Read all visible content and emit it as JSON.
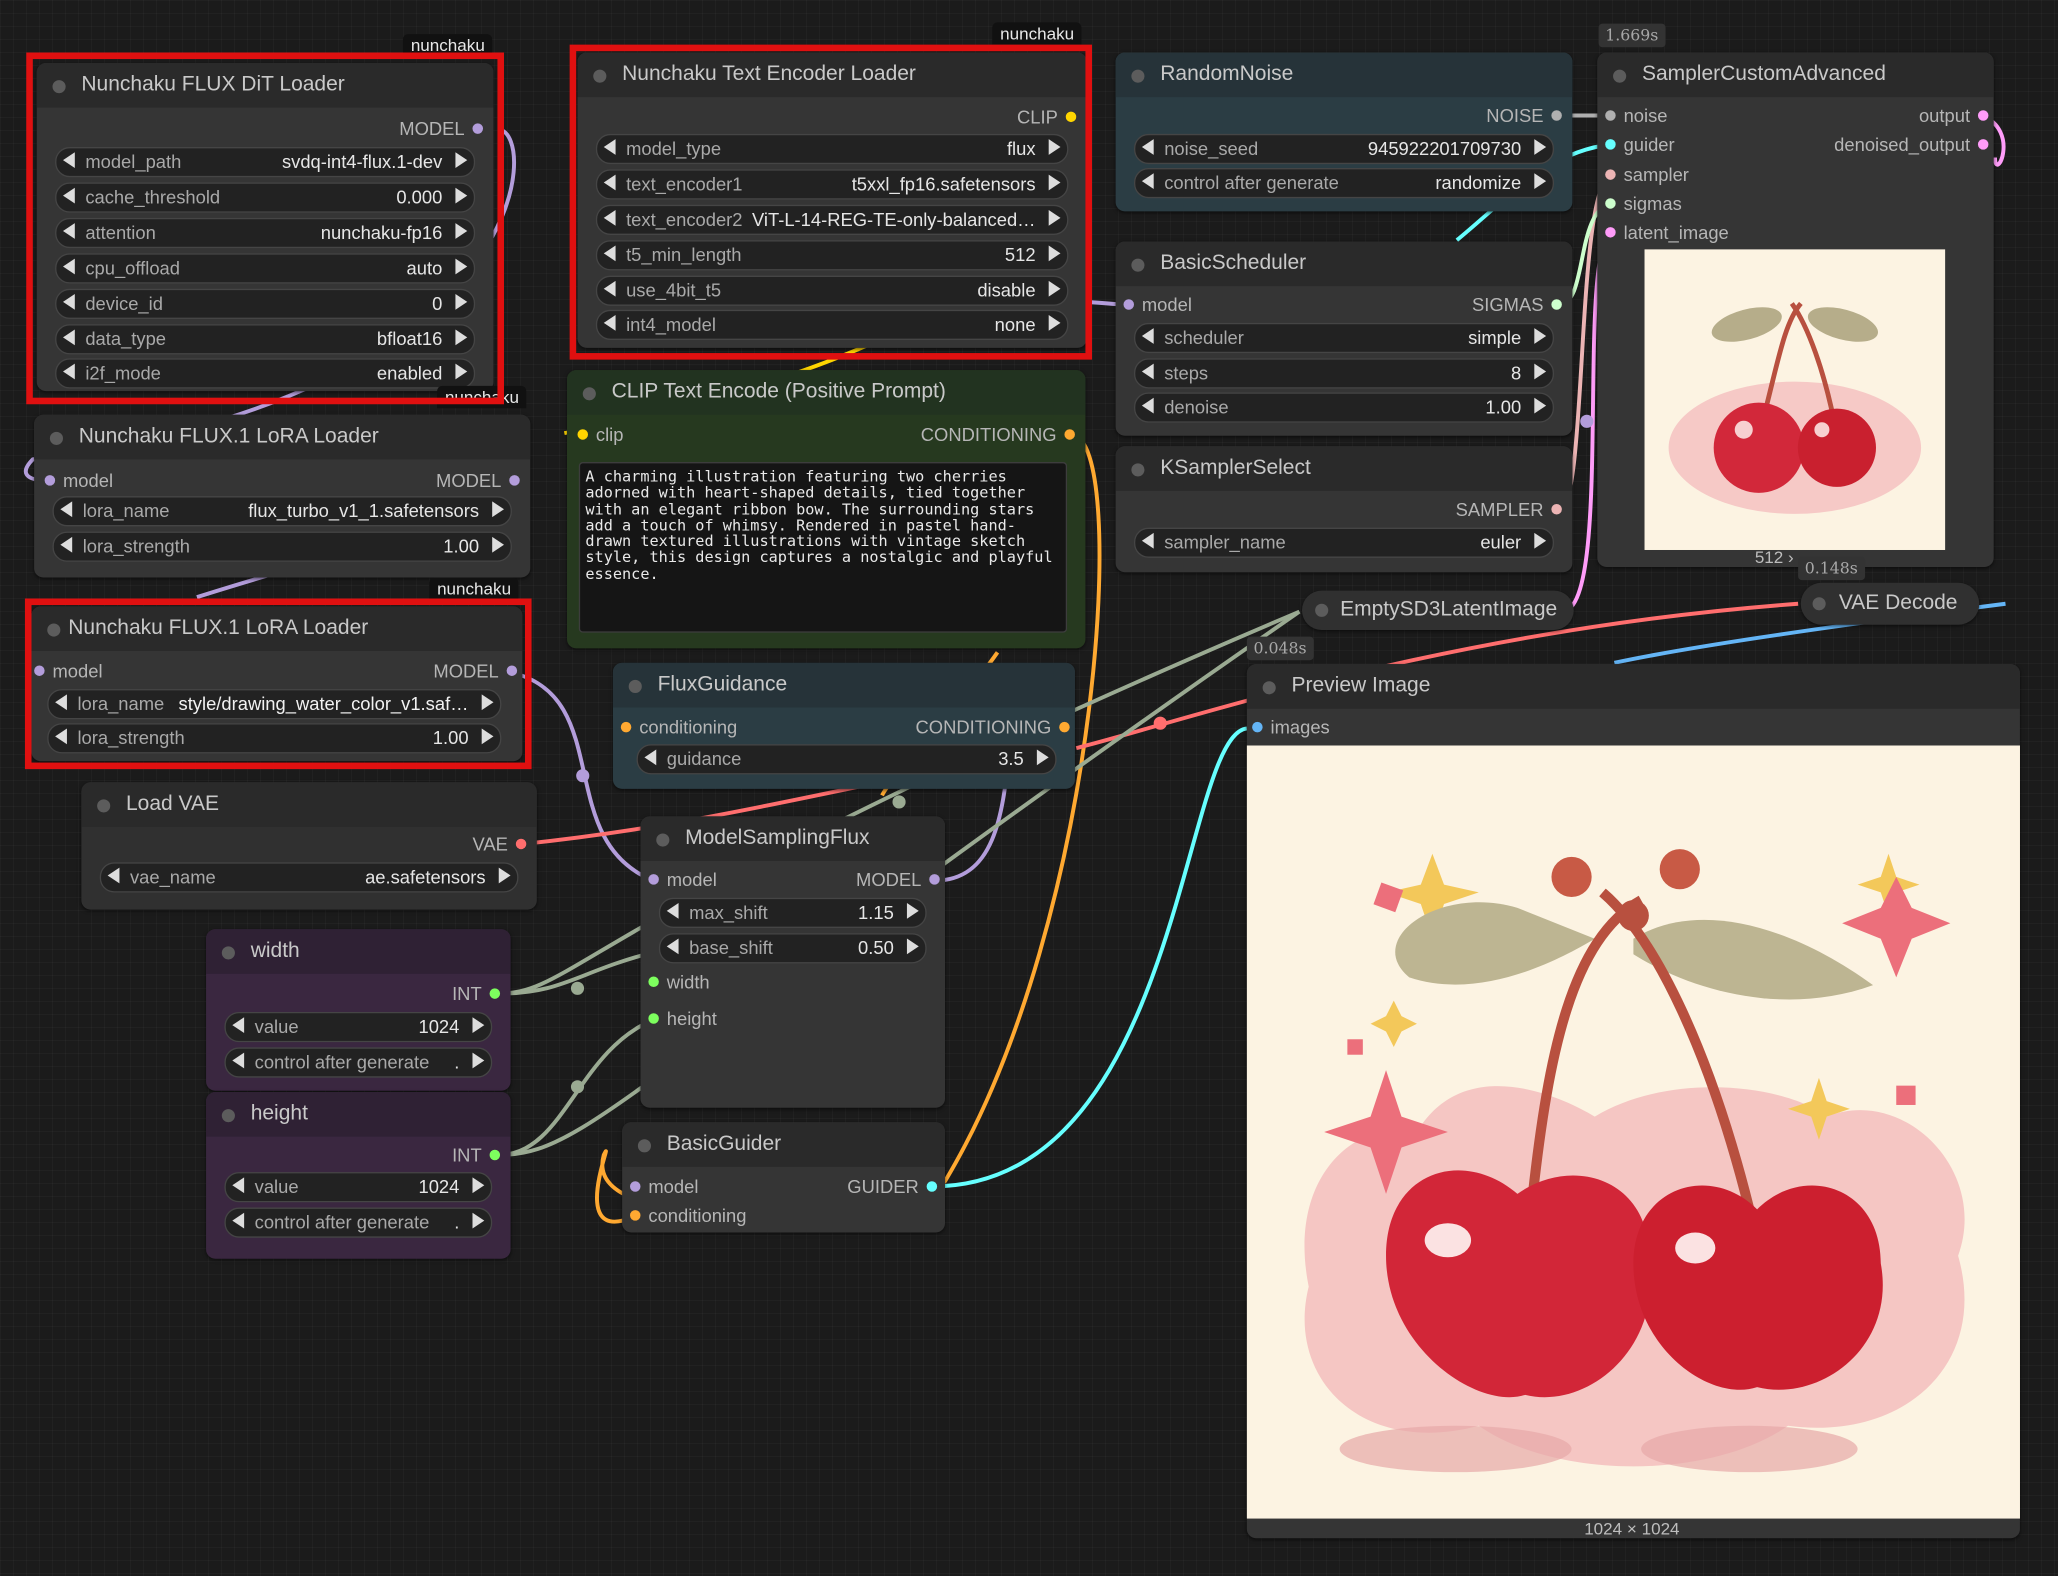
{
  "badges": {
    "nunchaku": "nunchaku"
  },
  "timings": {
    "sampler": "1.669s",
    "vae_decode": "0.148s",
    "empty_latent": "0.048s"
  },
  "dit_loader": {
    "title": "Nunchaku FLUX DiT Loader",
    "output": "MODEL",
    "widgets": [
      {
        "label": "model_path",
        "value": "svdq-int4-flux.1-dev"
      },
      {
        "label": "cache_threshold",
        "value": "0.000"
      },
      {
        "label": "attention",
        "value": "nunchaku-fp16"
      },
      {
        "label": "cpu_offload",
        "value": "auto"
      },
      {
        "label": "device_id",
        "value": "0"
      },
      {
        "label": "data_type",
        "value": "bfloat16"
      },
      {
        "label": "i2f_mode",
        "value": "enabled"
      }
    ]
  },
  "text_encoder_loader": {
    "title": "Nunchaku Text Encoder Loader",
    "output": "CLIP",
    "widgets": [
      {
        "label": "model_type",
        "value": "flux"
      },
      {
        "label": "text_encoder1",
        "value": "t5xxl_fp16.safetensors"
      },
      {
        "label": "text_encoder2",
        "value": "ViT-L-14-REG-TE-only-balanced…"
      },
      {
        "label": "t5_min_length",
        "value": "512"
      },
      {
        "label": "use_4bit_t5",
        "value": "disable"
      },
      {
        "label": "int4_model",
        "value": "none"
      }
    ]
  },
  "lora1": {
    "title": "Nunchaku FLUX.1 LoRA Loader",
    "input": "model",
    "output": "MODEL",
    "widgets": [
      {
        "label": "lora_name",
        "value": "flux_turbo_v1_1.safetensors"
      },
      {
        "label": "lora_strength",
        "value": "1.00"
      }
    ]
  },
  "lora2": {
    "title": "Nunchaku FLUX.1 LoRA Loader",
    "input": "model",
    "output": "MODEL",
    "widgets": [
      {
        "label": "lora_name",
        "value": "style/drawing_water_color_v1.saf…"
      },
      {
        "label": "lora_strength",
        "value": "1.00"
      }
    ]
  },
  "clip_encode": {
    "title": "CLIP Text Encode (Positive Prompt)",
    "input": "clip",
    "output": "CONDITIONING",
    "text": "A charming illustration featuring two cherries adorned with heart-shaped details, tied together with an elegant ribbon bow. The surrounding stars add a touch of whimsy. Rendered in pastel hand-drawn textured illustrations with vintage sketch style, this design captures a nostalgic and playful essence."
  },
  "load_vae": {
    "title": "Load VAE",
    "output": "VAE",
    "widgets": [
      {
        "label": "vae_name",
        "value": "ae.safetensors"
      }
    ]
  },
  "width_node": {
    "title": "width",
    "output": "INT",
    "widgets": [
      {
        "label": "value",
        "value": "1024"
      },
      {
        "label": "control after generate",
        "value": "."
      }
    ]
  },
  "height_node": {
    "title": "height",
    "output": "INT",
    "widgets": [
      {
        "label": "value",
        "value": "1024"
      },
      {
        "label": "control after generate",
        "value": "."
      }
    ]
  },
  "flux_guidance": {
    "title": "FluxGuidance",
    "input": "conditioning",
    "output": "CONDITIONING",
    "widgets": [
      {
        "label": "guidance",
        "value": "3.5"
      }
    ]
  },
  "model_sampling": {
    "title": "ModelSamplingFlux",
    "input_model": "model",
    "output": "MODEL",
    "widgets": [
      {
        "label": "max_shift",
        "value": "1.15"
      },
      {
        "label": "base_shift",
        "value": "0.50"
      }
    ],
    "input_width": "width",
    "input_height": "height"
  },
  "basic_guider": {
    "title": "BasicGuider",
    "input_model": "model",
    "input_cond": "conditioning",
    "output": "GUIDER"
  },
  "random_noise": {
    "title": "RandomNoise",
    "output": "NOISE",
    "widgets": [
      {
        "label": "noise_seed",
        "value": "945922201709730"
      },
      {
        "label": "control after generate",
        "value": "randomize"
      }
    ]
  },
  "basic_scheduler": {
    "title": "BasicScheduler",
    "input": "model",
    "output": "SIGMAS",
    "widgets": [
      {
        "label": "scheduler",
        "value": "simple"
      },
      {
        "label": "steps",
        "value": "8"
      },
      {
        "label": "denoise",
        "value": "1.00"
      }
    ]
  },
  "ksampler_select": {
    "title": "KSamplerSelect",
    "output": "SAMPLER",
    "widgets": [
      {
        "label": "sampler_name",
        "value": "euler"
      }
    ]
  },
  "sampler_custom": {
    "title": "SamplerCustomAdvanced",
    "inputs": [
      "noise",
      "guider",
      "sampler",
      "sigmas",
      "latent_image"
    ],
    "outputs": [
      "output",
      "denoised_output"
    ],
    "size_label": "512 ›"
  },
  "empty_latent": {
    "title": "EmptySD3LatentImage"
  },
  "vae_decode": {
    "title": "VAE Decode"
  },
  "preview": {
    "title": "Preview Image",
    "input": "images",
    "size_label": "1024 × 1024"
  },
  "colors": {
    "model": "#b39ddb",
    "clip": "#ffd500",
    "conditioning": "#ffa931",
    "vae": "#ff6e6e",
    "int": "#7dff5e",
    "latent": "#ff9cf9",
    "noise": "#b0b0b0",
    "guider": "#66ffff",
    "sampler": "#ecb4b4",
    "sigmas": "#cdffcd",
    "image": "#64b5f6",
    "highlight": "#e01010"
  }
}
